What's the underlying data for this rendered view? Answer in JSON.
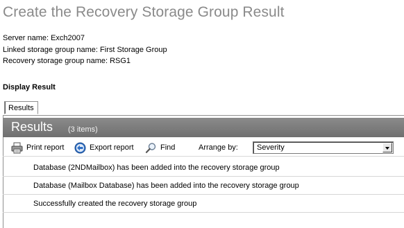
{
  "page": {
    "title": "Create the Recovery Storage Group Result",
    "server_line": "Server name: Exch2007",
    "linked_line": "Linked storage group name: First Storage Group",
    "recovery_line": "Recovery storage group name: RSG1",
    "display_result_label": "Display Result"
  },
  "tabs": [
    {
      "label": "Results"
    }
  ],
  "results": {
    "title": "Results",
    "count": "(3 items)",
    "toolbar": {
      "print_label": "Print report",
      "export_label": "Export report",
      "find_label": "Find",
      "arrange_label": "Arrange by:",
      "arrange_value": "Severity"
    },
    "items": [
      {
        "text": "Database (2NDMailbox) has been added into the recovery storage group"
      },
      {
        "text": "Database (Mailbox Database) has been added into the recovery storage group"
      },
      {
        "text": "Successfully created the recovery storage group"
      }
    ]
  },
  "icons": {
    "print": "printer-icon",
    "export": "export-arrow-icon",
    "find": "magnifier-icon",
    "dropdown": "chevron-down-icon"
  },
  "colors": {
    "title_gray": "#8a8a8a",
    "header_bar": "#7d7d7d",
    "export_blue": "#2f6fc4"
  }
}
